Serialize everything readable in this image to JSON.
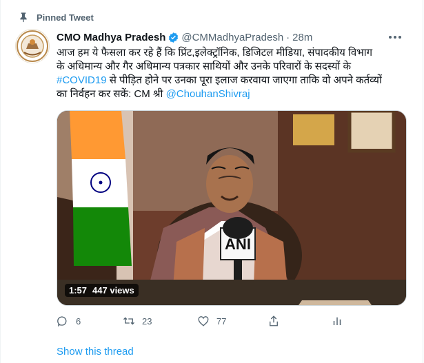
{
  "pinned_label": "Pinned Tweet",
  "author": {
    "name": "CMO Madhya Pradesh",
    "handle": "@CMMadhyaPradesh",
    "time": "28m"
  },
  "tweet": {
    "text_lines": [
      "आज हम ये फैसला कर रहे हैं कि प्रिंट,इलेक्ट्रॉनिक, डिजिटल मीडिया, संपादकीय विभाग",
      "के अधिमान्य और गैर अधिमान्य पत्रकार साथियों और उनके परिवारों के सदस्यों के",
      "से पीड़ित होने पर उनका पूरा इलाज करवाया जाएगा ताकि वो अपने कर्तव्यों",
      "का निर्वहन कर सकें: CM श्री"
    ],
    "hashtag": "#COVID19",
    "mention": "@ChouhanShivraj"
  },
  "video": {
    "duration": "1:57",
    "views": "447 views",
    "mic_label": "ANI"
  },
  "actions": {
    "replies": "6",
    "retweets": "23",
    "likes": "77"
  },
  "show_thread": "Show this thread",
  "colors": {
    "accent": "#1d9bf0",
    "secondary_text": "#536471",
    "verified": "#1d9bf0"
  }
}
